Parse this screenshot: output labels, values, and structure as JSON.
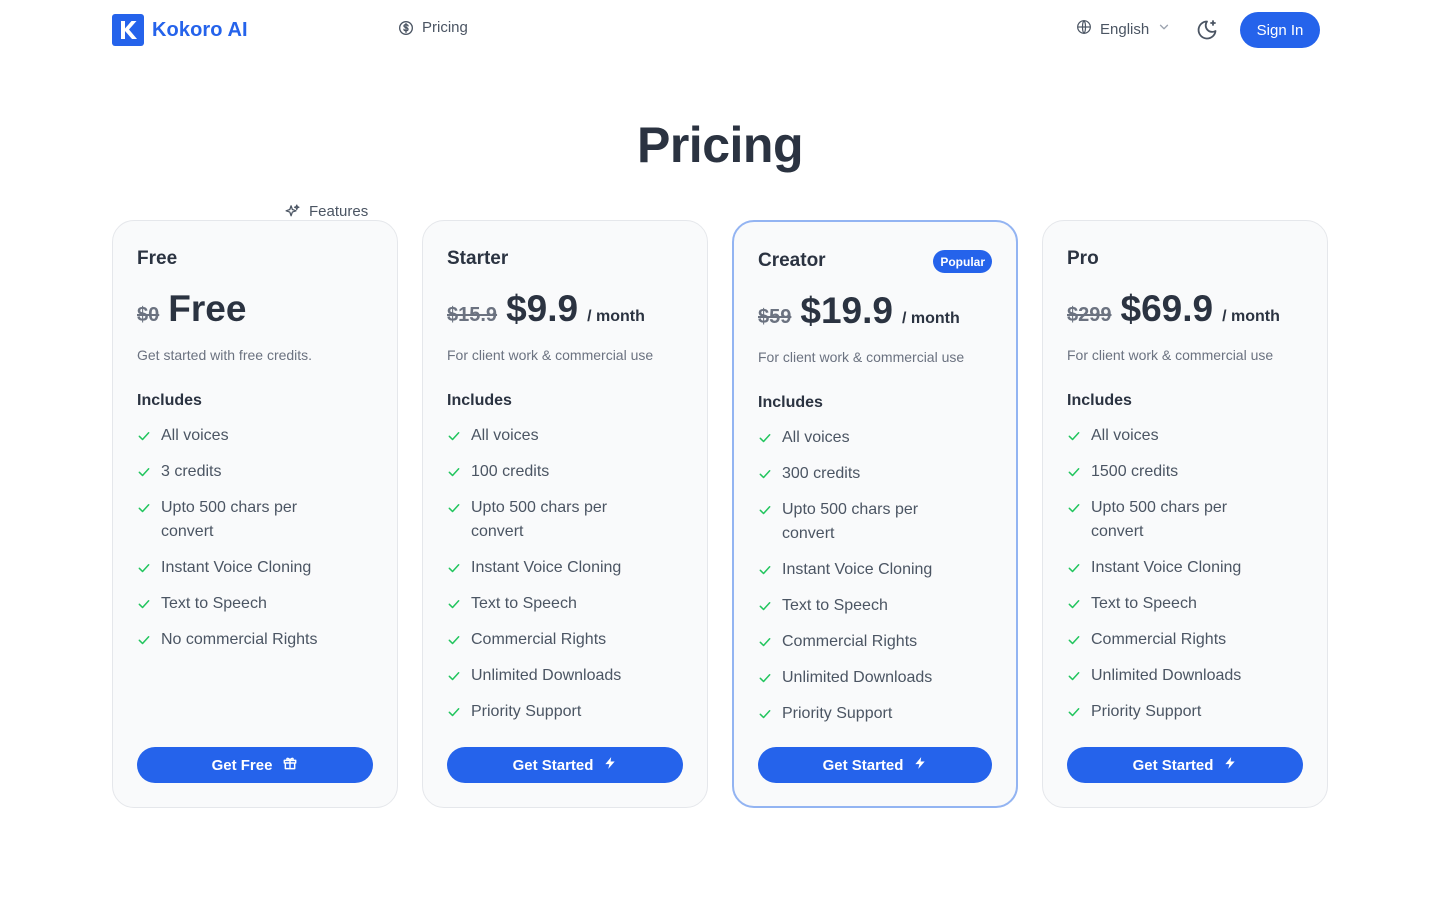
{
  "nav": {
    "brand_letter": "K",
    "brand_name": "Kokoro AI",
    "features_label": "Features",
    "pricing_label": "Pricing",
    "language": "English",
    "sign_in_label": "Sign In"
  },
  "page": {
    "title": "Pricing"
  },
  "colors": {
    "accent": "#2563eb",
    "check": "#22c55e",
    "popular_border": "#93b4f2"
  },
  "plans": [
    {
      "name": "Free",
      "old_price": "$0",
      "price": "Free",
      "period": "",
      "description": "Get started with free credits.",
      "includes_label": "Includes",
      "features": [
        "All voices",
        "3 credits",
        "Upto 500 chars per convert",
        "Instant Voice Cloning",
        "Text to Speech",
        "No commercial Rights"
      ],
      "cta_label": "Get Free",
      "cta_icon": "gift-icon"
    },
    {
      "name": "Starter",
      "old_price": "$15.9",
      "price": "$9.9",
      "period": "/ month",
      "description": "For client work & commercial use",
      "includes_label": "Includes",
      "features": [
        "All voices",
        "100 credits",
        "Upto 500 chars per convert",
        "Instant Voice Cloning",
        "Text to Speech",
        "Commercial Rights",
        "Unlimited Downloads",
        "Priority Support"
      ],
      "cta_label": "Get Started",
      "cta_icon": "bolt-icon"
    },
    {
      "name": "Creator",
      "badge": "Popular",
      "old_price": "$59",
      "price": "$19.9",
      "period": "/ month",
      "description": "For client work & commercial use",
      "includes_label": "Includes",
      "features": [
        "All voices",
        "300 credits",
        "Upto 500 chars per convert",
        "Instant Voice Cloning",
        "Text to Speech",
        "Commercial Rights",
        "Unlimited Downloads",
        "Priority Support"
      ],
      "cta_label": "Get Started",
      "cta_icon": "bolt-icon"
    },
    {
      "name": "Pro",
      "old_price": "$299",
      "price": "$69.9",
      "period": "/ month",
      "description": "For client work & commercial use",
      "includes_label": "Includes",
      "features": [
        "All voices",
        "1500 credits",
        "Upto 500 chars per convert",
        "Instant Voice Cloning",
        "Text to Speech",
        "Commercial Rights",
        "Unlimited Downloads",
        "Priority Support"
      ],
      "cta_label": "Get Started",
      "cta_icon": "bolt-icon"
    }
  ]
}
